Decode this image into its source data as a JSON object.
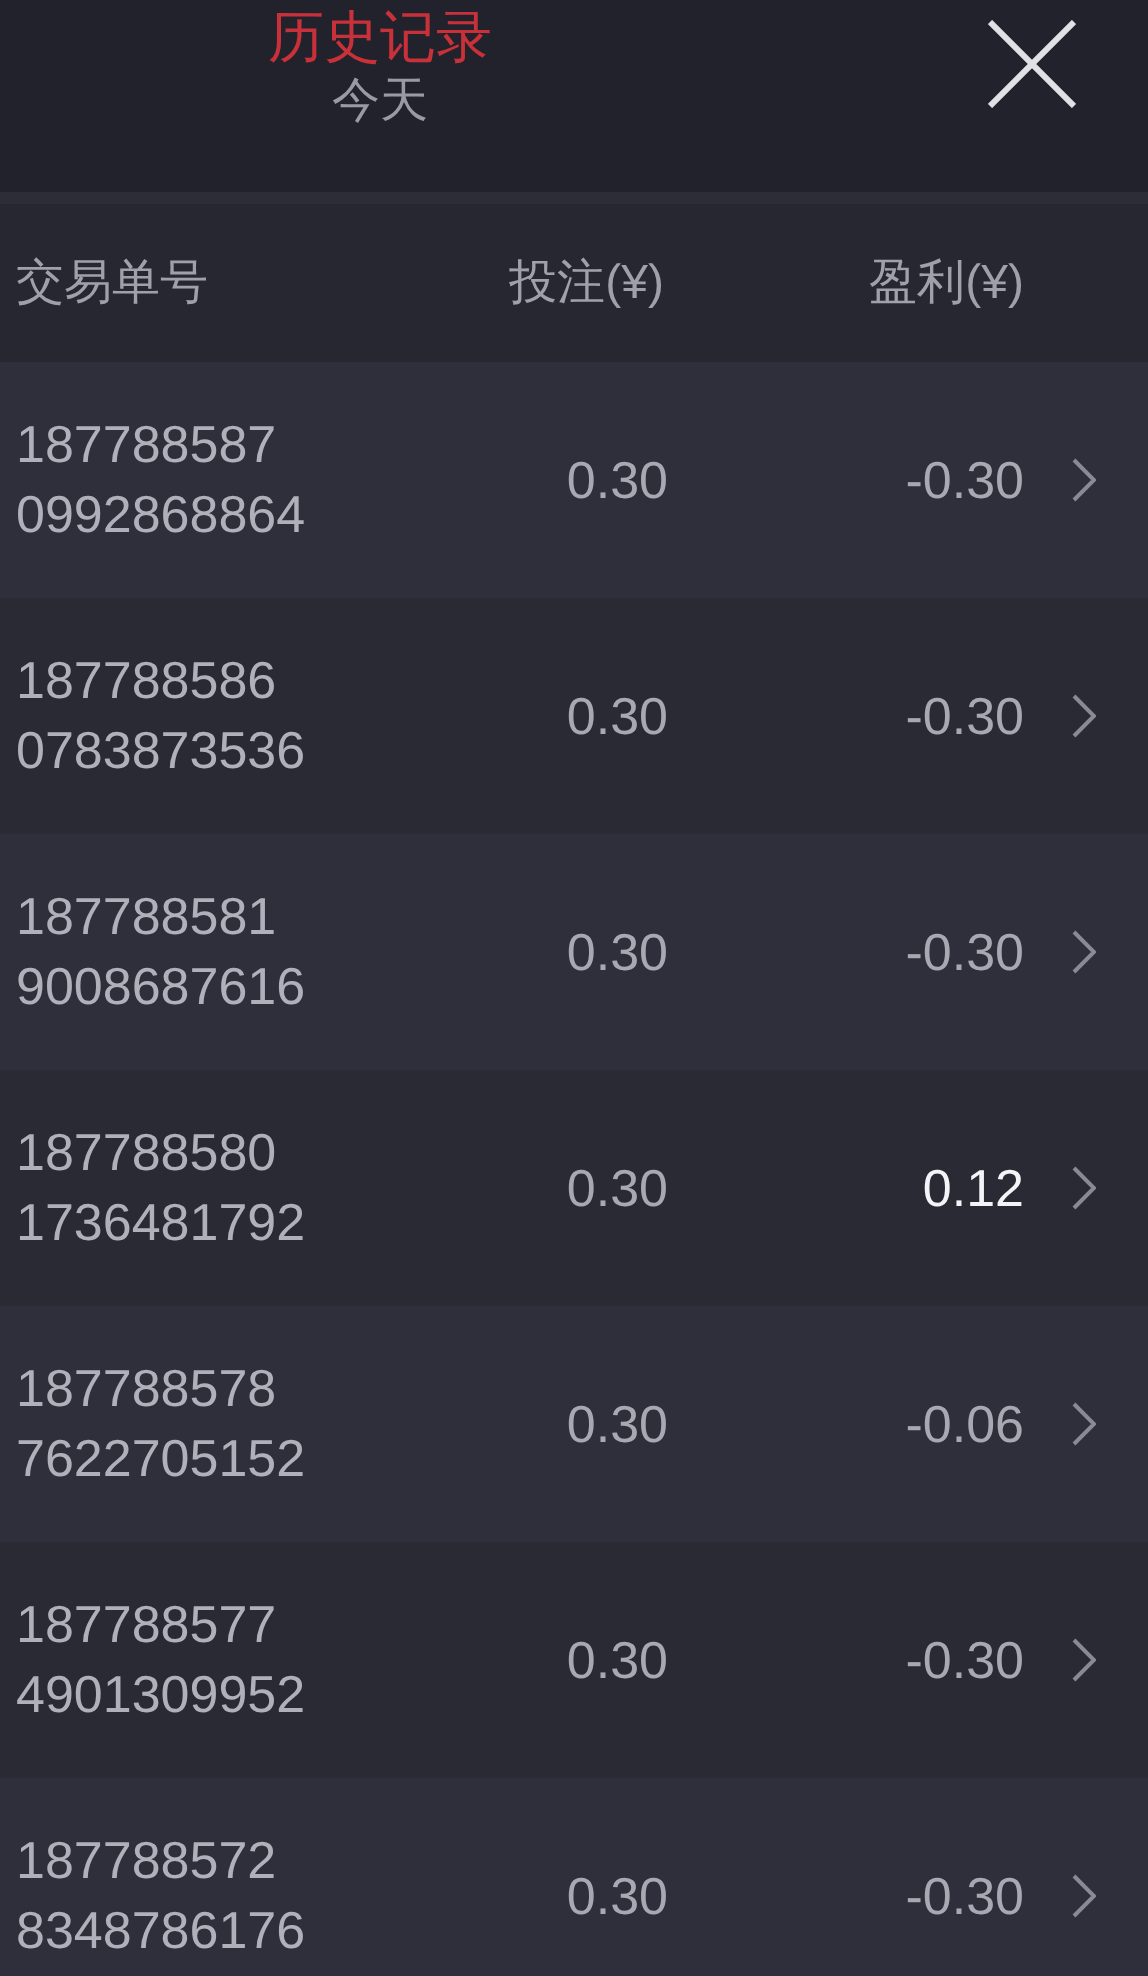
{
  "header": {
    "title": "历史记录",
    "subtitle": "今天"
  },
  "table": {
    "columns": [
      "交易单号",
      "投注(¥)",
      "盈利(¥)"
    ],
    "rows": [
      {
        "order_id": "187788587\n0992868864",
        "bet": "0.30",
        "profit": "-0.30",
        "kind": "loss"
      },
      {
        "order_id": "187788586\n0783873536",
        "bet": "0.30",
        "profit": "-0.30",
        "kind": "loss"
      },
      {
        "order_id": "187788581\n9008687616",
        "bet": "0.30",
        "profit": "-0.30",
        "kind": "loss"
      },
      {
        "order_id": "187788580\n1736481792",
        "bet": "0.30",
        "profit": "0.12",
        "kind": "win"
      },
      {
        "order_id": "187788578\n7622705152",
        "bet": "0.30",
        "profit": "-0.06",
        "kind": "loss"
      },
      {
        "order_id": "187788577\n4901309952",
        "bet": "0.30",
        "profit": "-0.30",
        "kind": "loss"
      },
      {
        "order_id": "187788572\n8348786176",
        "bet": "0.30",
        "profit": "-0.30",
        "kind": "loss"
      }
    ]
  }
}
